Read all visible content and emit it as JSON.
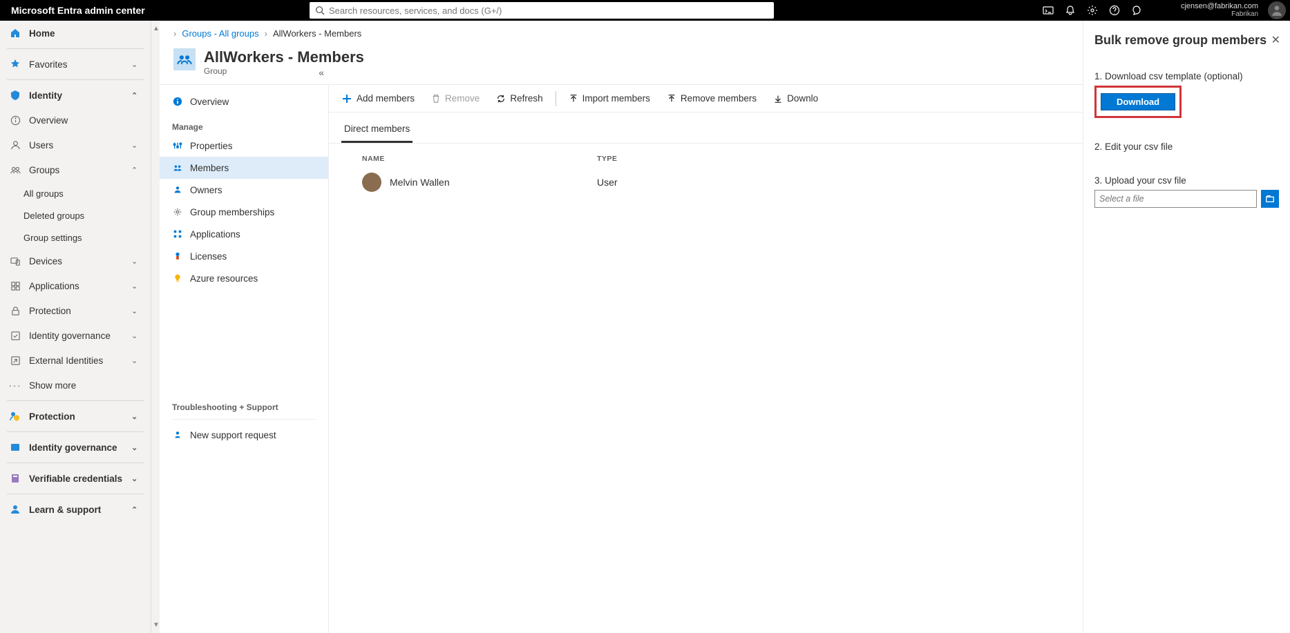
{
  "header": {
    "product": "Microsoft Entra admin center",
    "search_placeholder": "Search resources, services, and docs (G+/)",
    "account_email": "cjensen@fabrikan.com",
    "tenant": "Fabrikan"
  },
  "leftnav": {
    "home": "Home",
    "favorites": "Favorites",
    "identity": "Identity",
    "identity_items": {
      "overview": "Overview",
      "users": "Users",
      "groups": "Groups",
      "groups_sub": {
        "all": "All groups",
        "deleted": "Deleted groups",
        "settings": "Group settings"
      },
      "devices": "Devices",
      "applications": "Applications",
      "protection": "Protection",
      "id_governance": "Identity governance",
      "external": "External Identities",
      "show_more": "Show more"
    },
    "protection2": "Protection",
    "id_governance2": "Identity governance",
    "verifiable": "Verifiable credentials",
    "learn": "Learn & support"
  },
  "breadcrumb": {
    "l1": "Groups - All groups",
    "current": "AllWorkers - Members"
  },
  "page": {
    "title": "AllWorkers - Members",
    "subtitle": "Group"
  },
  "submenu": {
    "overview": "Overview",
    "manage_header": "Manage",
    "properties": "Properties",
    "members": "Members",
    "owners": "Owners",
    "group_memberships": "Group memberships",
    "applications": "Applications",
    "licenses": "Licenses",
    "azure_resources": "Azure resources",
    "ts_header": "Troubleshooting + Support",
    "support": "New support request"
  },
  "toolbar": {
    "add": "Add members",
    "remove": "Remove",
    "refresh": "Refresh",
    "import": "Import members",
    "remove_members": "Remove members",
    "download": "Downlo"
  },
  "tabs": {
    "direct": "Direct members"
  },
  "table": {
    "col_name": "NAME",
    "col_type": "TYPE",
    "rows": [
      {
        "name": "Melvin Wallen",
        "type": "User"
      }
    ]
  },
  "flyout": {
    "title": "Bulk remove group members",
    "step1": "1. Download csv template (optional)",
    "download_btn": "Download",
    "step2": "2. Edit your csv file",
    "step3": "3. Upload your csv file",
    "file_placeholder": "Select a file"
  }
}
